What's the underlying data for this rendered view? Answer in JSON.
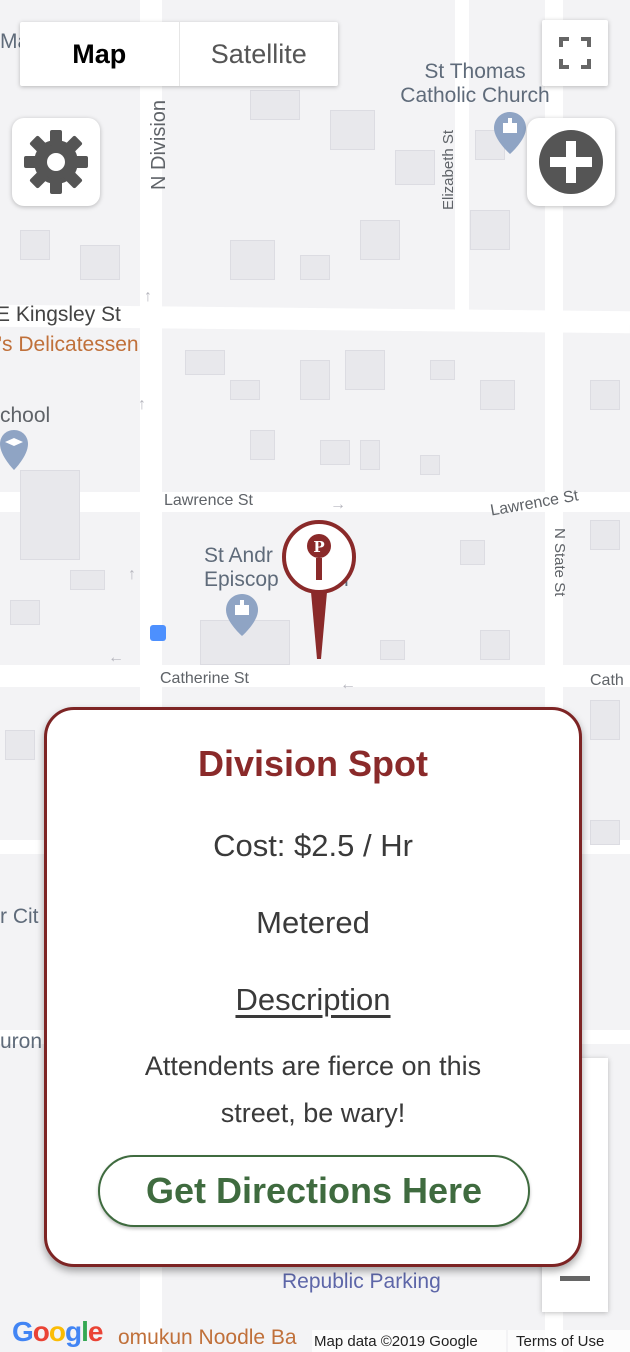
{
  "map_type": {
    "map_label": "Map",
    "satellite_label": "Satellite",
    "selected": "Map"
  },
  "controls": {
    "settings_icon": "gear-icon",
    "add_icon": "plus-circle-icon",
    "fullscreen_icon": "fullscreen-icon",
    "zoom_out_icon": "minus-icon"
  },
  "streets": {
    "n_division": "N Division",
    "elizabeth": "Elizabeth St",
    "kingsley": "E Kingsley St",
    "lawrence_left": "Lawrence St",
    "lawrence_right": "Lawrence St",
    "n_state": "N State St",
    "catherine": "Catherine St",
    "cath_partial": "Cath"
  },
  "pois": {
    "st_thomas": "St Thomas\nCatholic Church",
    "st_andrews": "St Andr\nEpiscop       rch",
    "delicatessen": "'s Delicatessen",
    "school": "chool",
    "ma": "Ma",
    "r_cit": "r Cit",
    "uron": "uron",
    "republic_parking": "Republic Parking",
    "noodle": "omukun Noodle Ba",
    "bar": "Bar"
  },
  "marker": {
    "label": "P",
    "color": "#8a2a2a"
  },
  "popup": {
    "title": "Division Spot",
    "cost": "Cost: $2.5 / Hr",
    "type": "Metered",
    "description_heading": "Description",
    "description": "Attendents are fierce on this street, be wary!",
    "button_label": "Get Directions Here"
  },
  "footer": {
    "logo": "Google",
    "map_data": "Map data ©2019 Google",
    "terms": "Terms of Use"
  },
  "colors": {
    "accent_red": "#8a2a2a",
    "button_green": "#3f6b3f",
    "map_bg": "#f3f3f5"
  }
}
